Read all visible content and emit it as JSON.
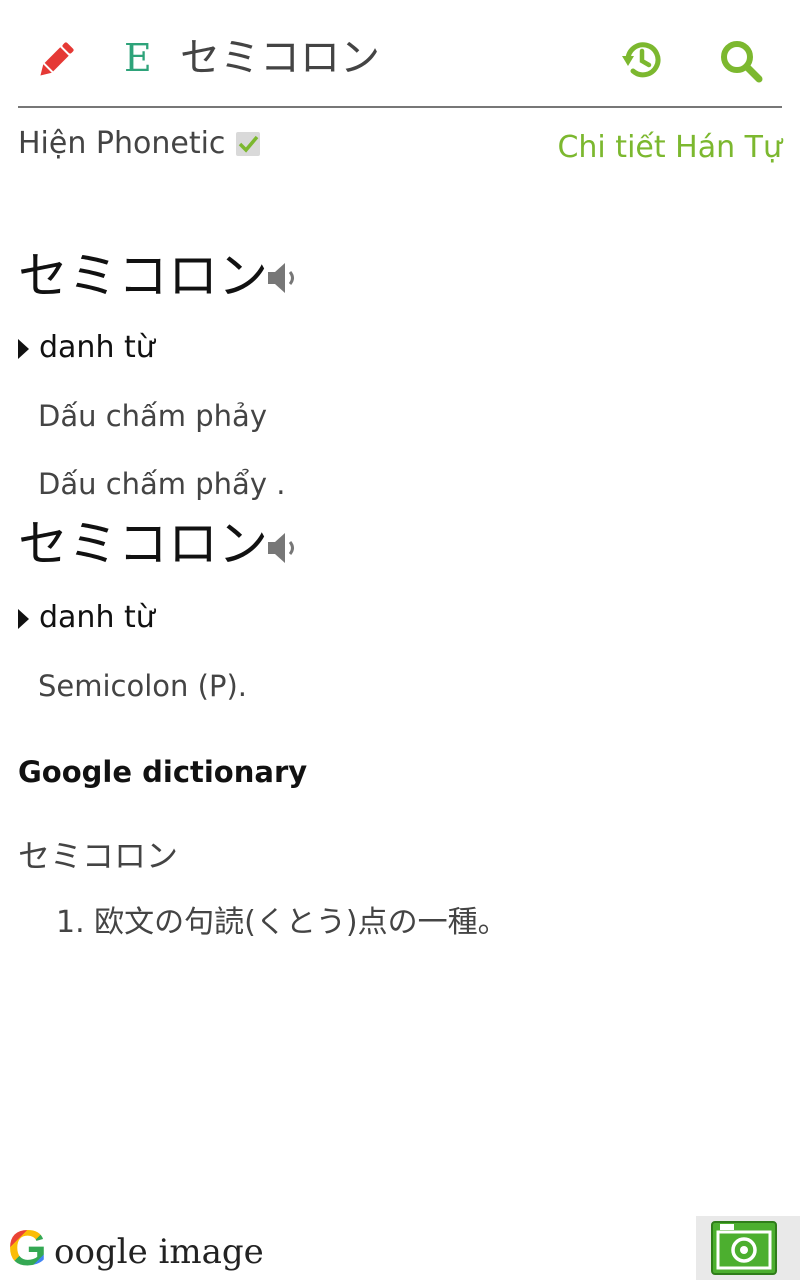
{
  "header": {
    "badge": "E",
    "query": "セミコロン"
  },
  "options": {
    "phonetic_label": "Hiện Phonetic",
    "phonetic_checked": true,
    "kanji_link": "Chi tiết Hán Tự"
  },
  "entries": [
    {
      "word": "セミコロン",
      "pos": "danh từ",
      "meanings": [
        "Dấu chấm phảy",
        "Dấu chấm phẩy ."
      ]
    },
    {
      "word": "セミコロン",
      "pos": "danh từ",
      "meanings": [
        "Semicolon (P)."
      ]
    }
  ],
  "google_dictionary": {
    "title": "Google dictionary",
    "word": "セミコロン",
    "definitions": [
      "1.  欧文の句読(くとう)点の一種。"
    ]
  },
  "footer": {
    "google_image_g": "G",
    "google_image_rest": "oogle image"
  },
  "colors": {
    "accent_green": "#7cb82f",
    "badge_teal": "#2ea37a",
    "pencil_red": "#e53935"
  }
}
